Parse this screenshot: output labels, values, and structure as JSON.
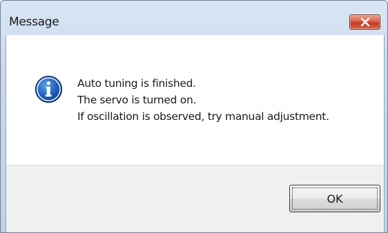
{
  "window": {
    "title": "Message",
    "close_icon": "close-icon"
  },
  "dialog": {
    "icon": "information-icon",
    "lines": [
      "Auto tuning is finished.",
      "The servo is turned on.",
      "If oscillation is observed, try manual adjustment."
    ],
    "ok_label": "OK"
  },
  "colors": {
    "titlebar": "#cad9ec",
    "close_button": "#c23a22",
    "info_icon": "#1c5fb8",
    "button_area": "#f0f0f0"
  }
}
